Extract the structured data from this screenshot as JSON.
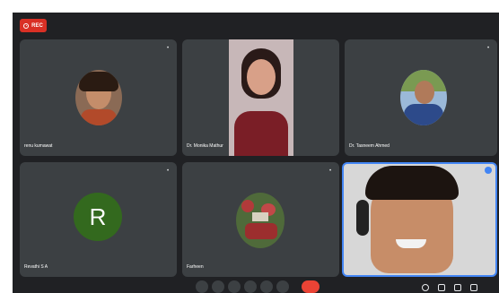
{
  "recording": {
    "label": "REC"
  },
  "participants": [
    {
      "name": "renu kumawat",
      "avatar": "photo"
    },
    {
      "name": "Dr. Monika Mathur",
      "avatar": "video"
    },
    {
      "name": "Dr. Tasneem Ahmed",
      "avatar": "photo"
    },
    {
      "name": "Revathi S A",
      "avatar": "initial",
      "initial": "R",
      "color": "#33691e"
    },
    {
      "name": "Farheen",
      "avatar": "photo"
    },
    {
      "name": "",
      "avatar": "video"
    }
  ],
  "footer": {
    "meeting_info": ""
  },
  "colors": {
    "background": "#202124",
    "tile": "#3c4043",
    "end_call": "#ea4335",
    "active_border": "#4285f4"
  },
  "icons": [
    "mic-icon",
    "camera-icon",
    "captions-icon",
    "present-icon",
    "raise-hand-icon",
    "more-icon",
    "end-call-icon",
    "info-icon",
    "people-icon",
    "chat-icon",
    "activities-icon"
  ]
}
